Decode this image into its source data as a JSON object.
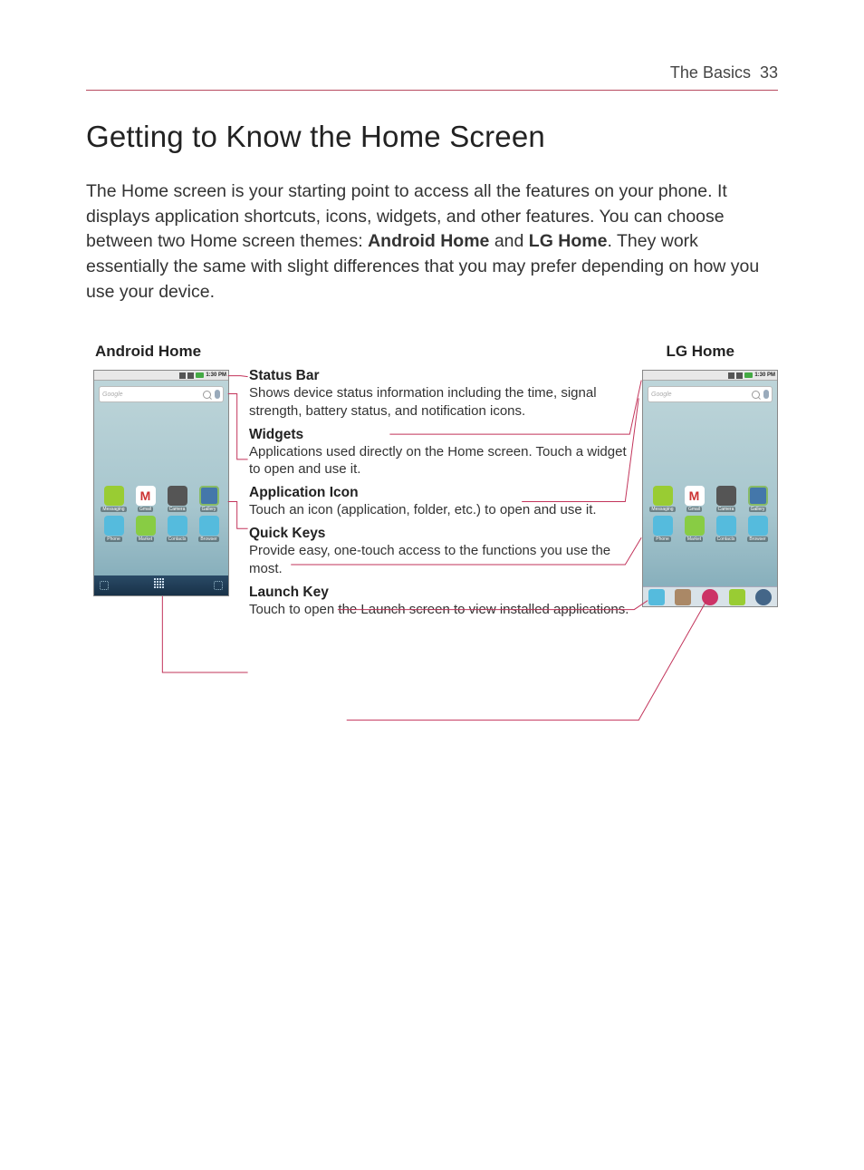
{
  "header": {
    "section": "The Basics",
    "page": "33"
  },
  "title": "Getting to Know the Home Screen",
  "intro": {
    "t1": "The Home screen is your starting point to access all the features on your phone. It displays application shortcuts, icons, widgets, and other features. You can choose between two Home screen themes: ",
    "b1": "Android Home",
    "t2": " and ",
    "b2": "LG Home",
    "t3": ". They work essentially the same with slight differences that you may prefer depending on how you use your device."
  },
  "labels": {
    "left": "Android Home",
    "right": "LG Home"
  },
  "phone": {
    "time": "1:30 PM",
    "searchPlaceholder": "Google",
    "apps_row1": [
      "Messaging",
      "Gmail",
      "Camera",
      "Gallery"
    ],
    "apps_row2": [
      "Phone",
      "Market",
      "Contacts",
      "Browser"
    ]
  },
  "callouts": [
    {
      "title": "Status Bar",
      "desc": "Shows device status information including the time, signal strength, battery status, and notification icons."
    },
    {
      "title": "Widgets",
      "desc": "Applications used directly on the Home screen. Touch a widget to open and use it."
    },
    {
      "title": "Application Icon",
      "desc": "Touch an icon (application, folder, etc.) to open and use it."
    },
    {
      "title": "Quick Keys",
      "desc": "Provide easy, one-touch access to the functions you use the most."
    },
    {
      "title": "Launch Key",
      "desc": "Touch to open the Launch screen to view installed applications."
    }
  ]
}
